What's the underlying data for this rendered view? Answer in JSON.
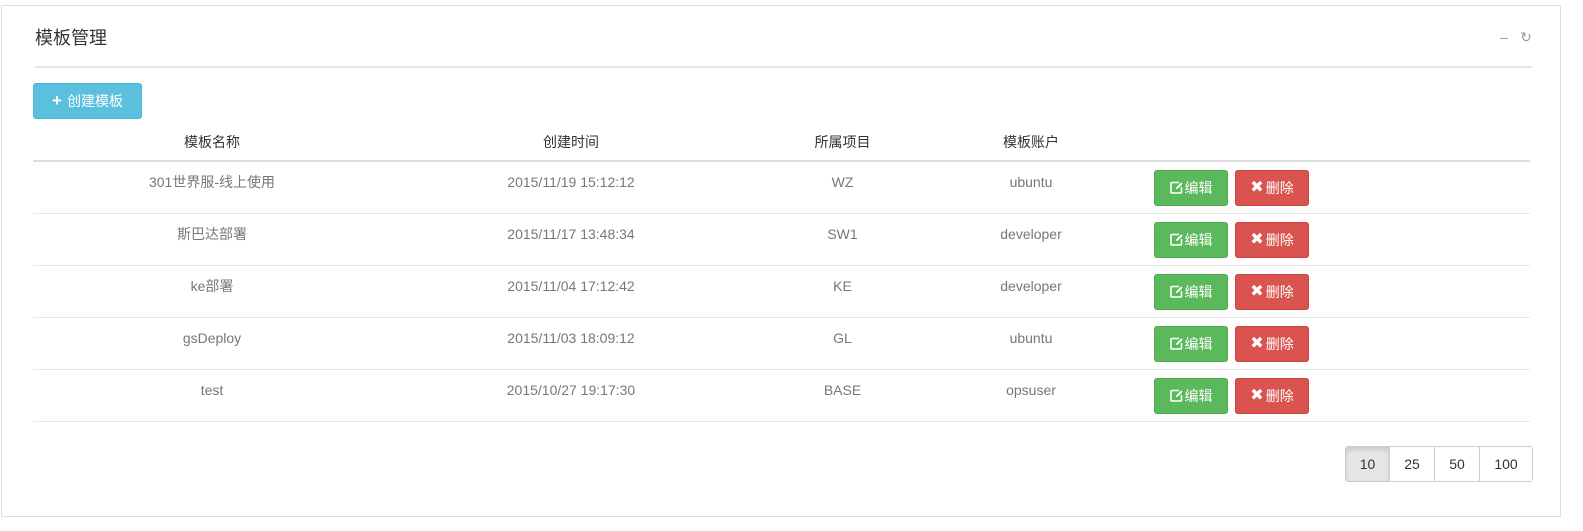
{
  "panel": {
    "title": "模板管理",
    "tools": [
      {
        "icon": "minimize-icon",
        "glyph": "–"
      },
      {
        "icon": "refresh-icon",
        "glyph": "↻"
      }
    ]
  },
  "toolbar": {
    "create_label": "创建模板",
    "create_icon": "plus-icon"
  },
  "table": {
    "columns": [
      "模板名称",
      "创建时间",
      "所属项目",
      "模板账户",
      ""
    ],
    "rows": [
      {
        "name": "301世界服-线上使用",
        "created": "2015/11/19 15:12:12",
        "project": "WZ",
        "account": "ubuntu"
      },
      {
        "name": "斯巴达部署",
        "created": "2015/11/17 13:48:34",
        "project": "SW1",
        "account": "developer"
      },
      {
        "name": "ke部署",
        "created": "2015/11/04 17:12:42",
        "project": "KE",
        "account": "developer"
      },
      {
        "name": "gsDeploy",
        "created": "2015/11/03 18:09:12",
        "project": "GL",
        "account": "ubuntu"
      },
      {
        "name": "test",
        "created": "2015/10/27 19:17:30",
        "project": "BASE",
        "account": "opsuser"
      }
    ],
    "edit_label": "编辑",
    "delete_label": "删除"
  },
  "page_size": {
    "options": [
      "10",
      "25",
      "50",
      "100"
    ],
    "selected": "10"
  },
  "colors": {
    "info": "#5bc0de",
    "success": "#5cb85c",
    "danger": "#d9534f"
  }
}
